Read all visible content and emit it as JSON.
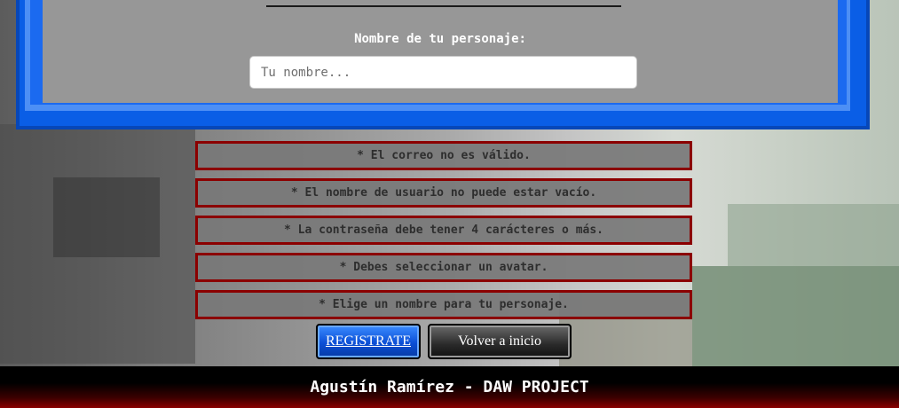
{
  "form": {
    "character_label": "Nombre de tu personaje:",
    "character_placeholder": "Tu nombre...",
    "character_value": ""
  },
  "errors": [
    "* El correo no es válido.",
    "* El nombre de usuario no puede estar vacío.",
    "* La contraseña debe tener 4 carácteres o más.",
    "* Debes seleccionar un avatar.",
    "* Elige un nombre para tu personaje."
  ],
  "buttons": {
    "register_label": "REGISTRATE",
    "home_label": "Volver a inicio"
  },
  "footer": {
    "text": "Agustín Ramírez - DAW PROJECT"
  },
  "colors": {
    "panel_blue": "#0a5ee6",
    "error_border": "#8b0000",
    "footer_red": "#8a0000"
  }
}
